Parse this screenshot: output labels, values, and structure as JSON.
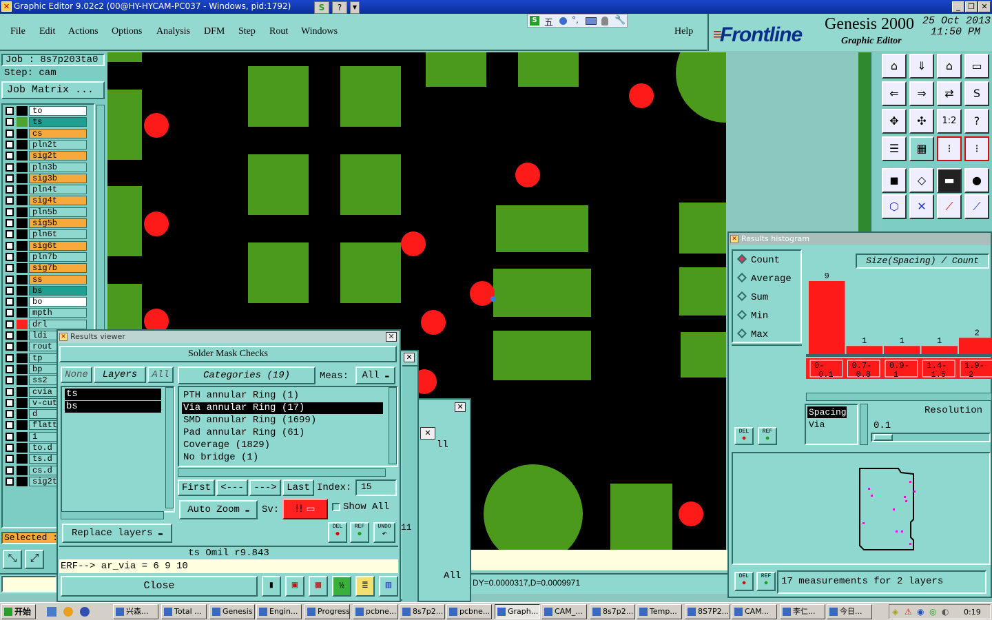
{
  "window": {
    "title": "Graphic Editor 9.02c2 (00@HY-HYCAM-PC037 - Windows, pid:1792)"
  },
  "menu": {
    "items": [
      "File",
      "Edit",
      "Actions",
      "Options",
      "Analysis",
      "DFM",
      "Step",
      "Rout",
      "Windows"
    ],
    "help": "Help"
  },
  "ime": {
    "label": "五"
  },
  "brand": {
    "logo": "Frontline",
    "product": "Genesis 2000",
    "subtitle": "Graphic Editor",
    "date": "25 Oct 2013",
    "time": "11:50 PM"
  },
  "job": {
    "job_label": "Job : 8s7p203ta0",
    "step_label": "Step: cam",
    "matrix_button": "Job Matrix ..."
  },
  "layers": [
    {
      "name": "to",
      "color": "#000000",
      "bg": "#ffffff"
    },
    {
      "name": "ts",
      "color": "#4da32e",
      "bg": "#1e9f8f"
    },
    {
      "name": "cs",
      "color": "#000000",
      "bg": "#f7a93b"
    },
    {
      "name": "pln2t",
      "color": "#000000",
      "bg": "#8fd8cf"
    },
    {
      "name": "sig2t",
      "color": "#000000",
      "bg": "#f7a93b"
    },
    {
      "name": "pln3b",
      "color": "#000000",
      "bg": "#8fd8cf"
    },
    {
      "name": "sig3b",
      "color": "#000000",
      "bg": "#f7a93b"
    },
    {
      "name": "pln4t",
      "color": "#000000",
      "bg": "#8fd8cf"
    },
    {
      "name": "sig4t",
      "color": "#000000",
      "bg": "#f7a93b"
    },
    {
      "name": "pln5b",
      "color": "#000000",
      "bg": "#8fd8cf"
    },
    {
      "name": "sig5b",
      "color": "#000000",
      "bg": "#f7a93b"
    },
    {
      "name": "pln6t",
      "color": "#000000",
      "bg": "#8fd8cf"
    },
    {
      "name": "sig6t",
      "color": "#000000",
      "bg": "#f7a93b"
    },
    {
      "name": "pln7b",
      "color": "#000000",
      "bg": "#8fd8cf"
    },
    {
      "name": "sig7b",
      "color": "#000000",
      "bg": "#f7a93b"
    },
    {
      "name": "ss",
      "color": "#000000",
      "bg": "#f7a93b"
    },
    {
      "name": "bs",
      "color": "#000000",
      "bg": "#1e9f8f"
    },
    {
      "name": "bo",
      "color": "#000000",
      "bg": "#ffffff"
    },
    {
      "name": "mpth",
      "color": "#000000",
      "bg": "#8fd8cf"
    },
    {
      "name": "drl",
      "color": "#ff2020",
      "bg": "#8fd8cf"
    },
    {
      "name": "ldi",
      "color": "#000000",
      "bg": "#8fd8cf"
    },
    {
      "name": "rout",
      "color": "#000000",
      "bg": "#8fd8cf"
    },
    {
      "name": "tp",
      "color": "#000000",
      "bg": "#8fd8cf"
    },
    {
      "name": "bp",
      "color": "#000000",
      "bg": "#8fd8cf"
    },
    {
      "name": "ss2",
      "color": "#000000",
      "bg": "#8fd8cf"
    },
    {
      "name": "cvia",
      "color": "#000000",
      "bg": "#8fd8cf"
    },
    {
      "name": "v-cut",
      "color": "#000000",
      "bg": "#8fd8cf"
    },
    {
      "name": "d",
      "color": "#000000",
      "bg": "#8fd8cf"
    },
    {
      "name": "flatte",
      "color": "#000000",
      "bg": "#8fd8cf"
    },
    {
      "name": "1",
      "color": "#000000",
      "bg": "#8fd8cf"
    },
    {
      "name": "to.d",
      "color": "#000000",
      "bg": "#8fd8cf"
    },
    {
      "name": "ts.d",
      "color": "#000000",
      "bg": "#8fd8cf"
    },
    {
      "name": "cs.d",
      "color": "#000000",
      "bg": "#8fd8cf"
    },
    {
      "name": "sig2t",
      "color": "#000000",
      "bg": "#8fd8cf"
    }
  ],
  "selected_label": "Selected :",
  "status": {
    "coords": "DY=0.0000317,D=0.0009971"
  },
  "results_viewer": {
    "title": "Results viewer",
    "header": "Solder Mask Checks",
    "none_btn": "None",
    "layers_btn": "Layers",
    "all_btn": "All",
    "categories_btn": "Categories (19)",
    "meas_label": "Meas:",
    "meas_value": "All",
    "layer_list": [
      "ts",
      "bs"
    ],
    "categories": [
      "PTH annular Ring (1)",
      "Via annular Ring (17)",
      "SMD annular Ring (1699)",
      "Pad annular Ring (61)",
      "Coverage (1829)",
      "No bridge (1)"
    ],
    "first_btn": "First",
    "prev_btn": "<---",
    "next_btn": "--->",
    "last_btn": "Last",
    "index_label": "Index:",
    "index_value": "15",
    "autozoom": "Auto Zoom",
    "sv_label": "Sv:",
    "sv_value": "!!",
    "show_all": "Show All",
    "replace_layers": "Replace layers",
    "del": "DEL",
    "ref": "REF",
    "undo": "UNDO",
    "info": "ts Omil   r9.843",
    "erf": "ERF--> ar_via = 6 9 10",
    "close": "Close"
  },
  "behind_windows": {
    "all_label": "All",
    "ll_label": "ll",
    "num": "11"
  },
  "histogram": {
    "title": "Results histogram",
    "modes": [
      "Count",
      "Average",
      "Sum",
      "Min",
      "Max"
    ],
    "selected_mode": "Count",
    "axis_label": "Size(Spacing) / Count",
    "spacing_label": "Spacing",
    "via_label": "Via",
    "resolution_label": "Resolution",
    "resolution_value": "0.1",
    "del": "DEL",
    "ref": "REF",
    "measurements": "17 measurements for 2 layers"
  },
  "chart_data": {
    "type": "bar",
    "categories": [
      "0-0.1",
      "0.7-0.8",
      "0.9-1",
      "1.4-1.5",
      "1.9-2"
    ],
    "values": [
      9,
      1,
      1,
      1,
      2
    ],
    "title": "Size(Spacing) / Count",
    "xlabel": "",
    "ylabel": "",
    "ylim": [
      0,
      9
    ]
  },
  "taskbar": {
    "start": "开始",
    "tasks": [
      "兴森...",
      "Total ...",
      "Genesis",
      "Engin...",
      "Progress",
      "pcbne...",
      "8s7p2...",
      "pcbne...",
      "Graph...",
      "CAM_...",
      "8s7p2...",
      "Temp...",
      "8S7P2...",
      "CAM...",
      "李仁...",
      "今日..."
    ],
    "clock": "0:19"
  }
}
